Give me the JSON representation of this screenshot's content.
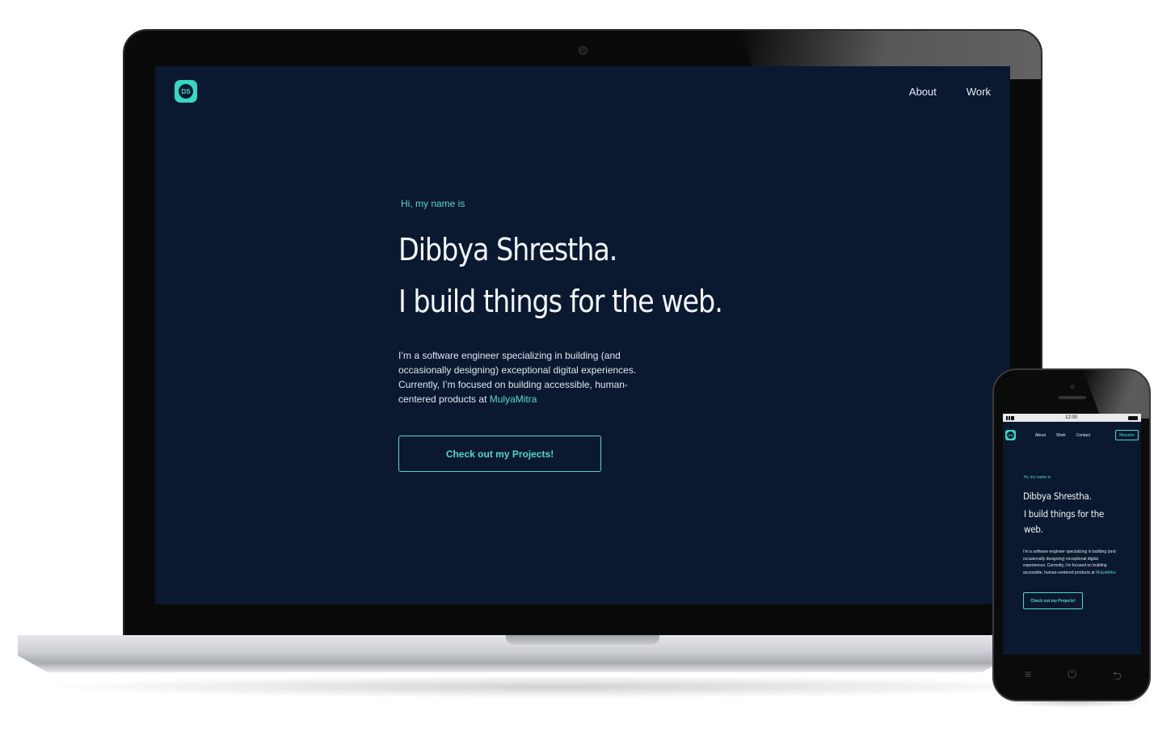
{
  "site": {
    "logo_text": "DS",
    "nav": [
      "About",
      "Work"
    ],
    "hero": {
      "greeting": "Hi, my name is",
      "name": "Dibbya Shrestha.",
      "tagline": "I build things for the web.",
      "description_prefix": "I’m a software engineer specializing in building (and occasionally designing) exceptional digital experiences. Currently, I’m focused on building accessible, human-centered products at ",
      "description_link": "MulyaMitra",
      "cta_label": "Check out my Projects!"
    }
  },
  "mobile": {
    "status_time": "12:00",
    "logo_text": "DS",
    "nav": [
      "About",
      "Work",
      "Contact"
    ],
    "resume_label": "Resume",
    "hero": {
      "greeting": "Hi, my name is",
      "name": "Dibbya Shrestha.",
      "tagline": "I build things for the web.",
      "description_prefix": "I’m a software engineer specializing in building (and occasionally designing) exceptional digital experiences. Currently, I’m focused on building accessible, human-centered products at ",
      "description_link": "MulyaMitra",
      "cta_label": "Check out my Projects!"
    },
    "buttons": [
      "menu-icon",
      "power-icon",
      "back-icon"
    ]
  },
  "colors": {
    "background": "#0b1930",
    "accent": "#4fd9c3",
    "text": "#f2f5fa"
  }
}
